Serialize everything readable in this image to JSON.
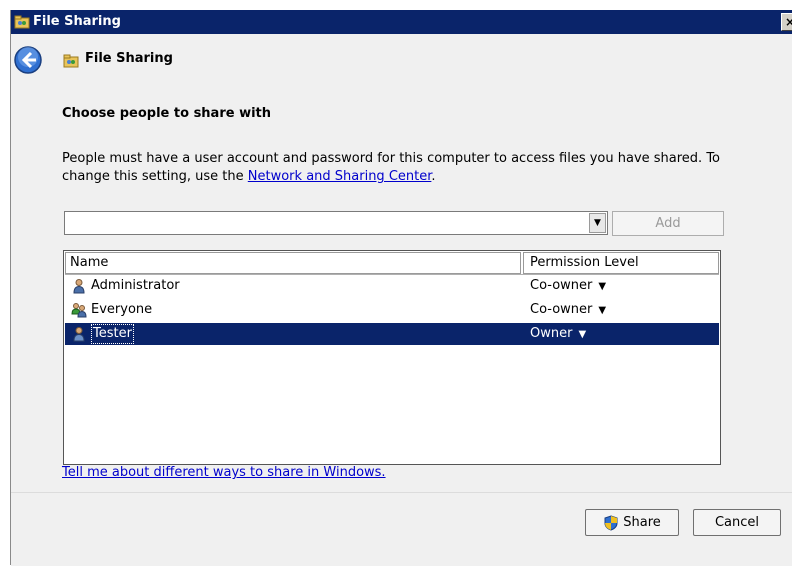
{
  "window": {
    "title": "File Sharing",
    "close_label": "×"
  },
  "header": {
    "title": "File Sharing"
  },
  "main": {
    "heading": "Choose people to share with",
    "description_text": "People must have a user account and password for this computer to access files you have shared.  To change this setting, use the ",
    "description_link": "Network and Sharing Center",
    "description_end": ".",
    "combo_value": "",
    "combo_placeholder": "",
    "dropdown_glyph": "▼",
    "add_label": "Add",
    "table": {
      "columns": [
        "Name",
        "Permission Level"
      ],
      "rows": [
        {
          "name": "Administrator",
          "permission": "Co-owner",
          "icon": "user-icon",
          "selected": false
        },
        {
          "name": "Everyone",
          "permission": "Co-owner",
          "icon": "group-icon",
          "selected": false
        },
        {
          "name": "Tester",
          "permission": "Owner",
          "icon": "user-icon",
          "selected": true
        }
      ]
    },
    "help_link": "Tell me about different ways to share in Windows."
  },
  "footer": {
    "share_label": "Share",
    "cancel_label": "Cancel"
  },
  "colors": {
    "titlebar": "#0a246a",
    "selection": "#0a246a",
    "link": "#0000cc"
  }
}
